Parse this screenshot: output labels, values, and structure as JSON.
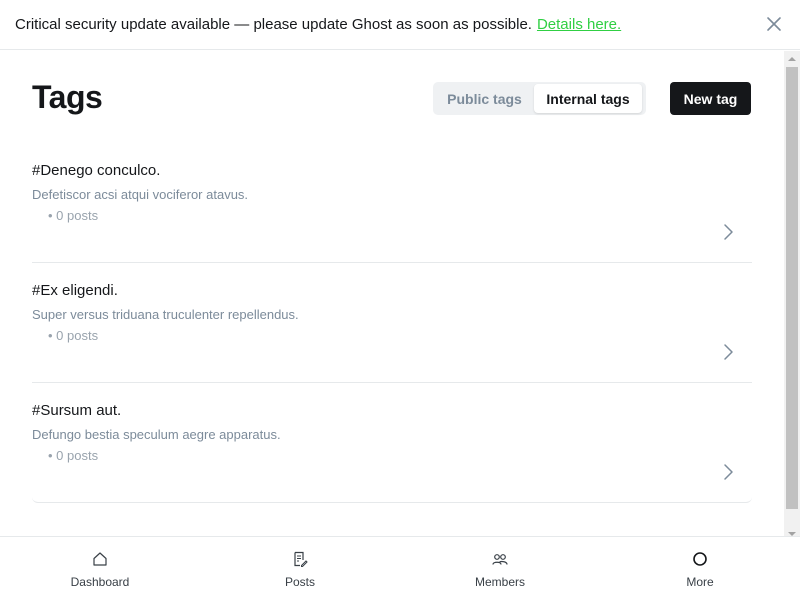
{
  "banner": {
    "message": "Critical security update available — please update Ghost as soon as possible.",
    "link": "Details here."
  },
  "page": {
    "title": "Tags"
  },
  "tabs": [
    {
      "label": "Public tags",
      "active": false
    },
    {
      "label": "Internal tags",
      "active": true
    }
  ],
  "actions": {
    "new_tag": "New tag"
  },
  "tags": [
    {
      "name": "#Denego conculco.",
      "description": "Defetiscor acsi atqui vociferor atavus.",
      "count": "• 0 posts"
    },
    {
      "name": "#Ex eligendi.",
      "description": "Super versus triduana truculenter repellendus.",
      "count": "• 0 posts"
    },
    {
      "name": "#Sursum aut.",
      "description": "Defungo bestia speculum aegre apparatus.",
      "count": "• 0 posts"
    }
  ],
  "nav": [
    {
      "label": "Dashboard",
      "icon": "home-icon"
    },
    {
      "label": "Posts",
      "icon": "posts-icon"
    },
    {
      "label": "Members",
      "icon": "members-icon"
    },
    {
      "label": "More",
      "icon": "more-icon"
    }
  ],
  "colors": {
    "accent_link": "#30cf43",
    "primary_button": "#15171a",
    "muted_text": "#7c8b9a"
  }
}
